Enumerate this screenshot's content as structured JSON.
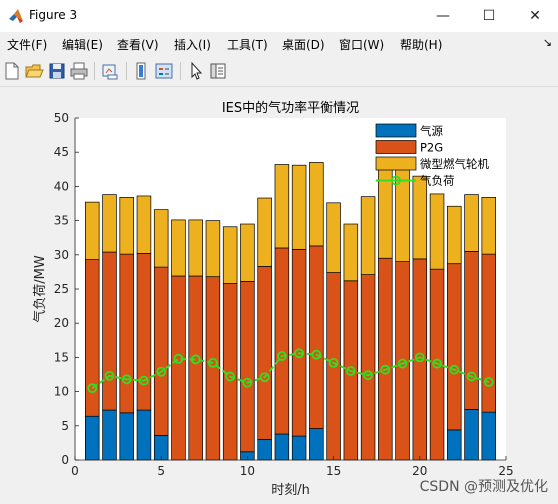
{
  "window": {
    "title": "Figure 3",
    "minimize_glyph": "—",
    "maximize_glyph": "☐",
    "close_glyph": "✕"
  },
  "menu": {
    "items": [
      "文件(F)",
      "编辑(E)",
      "查看(V)",
      "插入(I)",
      "工具(T)",
      "桌面(D)",
      "窗口(W)",
      "帮助(H)"
    ],
    "overflow_glyph": "↘"
  },
  "toolbar": {
    "icons": [
      "new-figure-icon",
      "open-file-icon",
      "save-icon",
      "print-icon",
      "link-plot-icon",
      "colorbar-icon",
      "legend-icon",
      "pointer-icon",
      "property-editor-icon"
    ]
  },
  "watermark": "CSDN @预测及优化",
  "colors": {
    "gas_source": "#0072BD",
    "p2g": "#D95319",
    "micro_turbine": "#EDB120",
    "gas_load": "#33DD22"
  },
  "chart_data": {
    "type": "bar",
    "stacked": true,
    "title": "IES中的气功率平衡情况",
    "xlabel": "时刻/h",
    "ylabel": "气负荷/MW",
    "xlim": [
      0,
      25
    ],
    "ylim": [
      0,
      50
    ],
    "xticks": [
      0,
      5,
      10,
      15,
      20,
      25
    ],
    "yticks": [
      0,
      5,
      10,
      15,
      20,
      25,
      30,
      35,
      40,
      45,
      50
    ],
    "x": [
      1,
      2,
      3,
      4,
      5,
      6,
      7,
      8,
      9,
      10,
      11,
      12,
      13,
      14,
      15,
      16,
      17,
      18,
      19,
      20,
      21,
      22,
      23,
      24
    ],
    "legend_position": "top-right",
    "grid": false,
    "series": [
      {
        "name": "气源",
        "type": "bar",
        "values": [
          6.4,
          7.3,
          6.9,
          7.3,
          3.6,
          0,
          0,
          0,
          0,
          1.2,
          3.0,
          3.8,
          3.5,
          4.6,
          0,
          0,
          0,
          0,
          0,
          0,
          0,
          4.4,
          7.4,
          7.0
        ]
      },
      {
        "name": "P2G",
        "type": "bar",
        "values": [
          22.9,
          23.1,
          23.2,
          22.9,
          24.6,
          26.9,
          26.9,
          26.8,
          25.8,
          24.9,
          25.3,
          27.2,
          27.3,
          26.7,
          27.4,
          26.2,
          27.1,
          29.5,
          29.0,
          29.4,
          27.9,
          24.3,
          23.1,
          23.1
        ]
      },
      {
        "name": "微型燃气轮机",
        "type": "bar",
        "values": [
          8.4,
          8.4,
          8.3,
          8.4,
          8.4,
          8.2,
          8.2,
          8.2,
          8.3,
          8.4,
          10.0,
          12.2,
          12.3,
          12.2,
          10.2,
          8.3,
          11.4,
          14.3,
          13.9,
          12.1,
          11.0,
          8.4,
          8.3,
          8.3
        ]
      },
      {
        "name": "气负荷",
        "type": "line",
        "values": [
          10.5,
          12.3,
          11.8,
          11.6,
          12.9,
          14.8,
          14.7,
          14.2,
          12.2,
          11.3,
          12.1,
          15.2,
          15.6,
          15.4,
          14.2,
          13.0,
          12.4,
          13.2,
          14.1,
          15.0,
          14.1,
          13.2,
          12.2,
          11.4
        ]
      }
    ]
  }
}
